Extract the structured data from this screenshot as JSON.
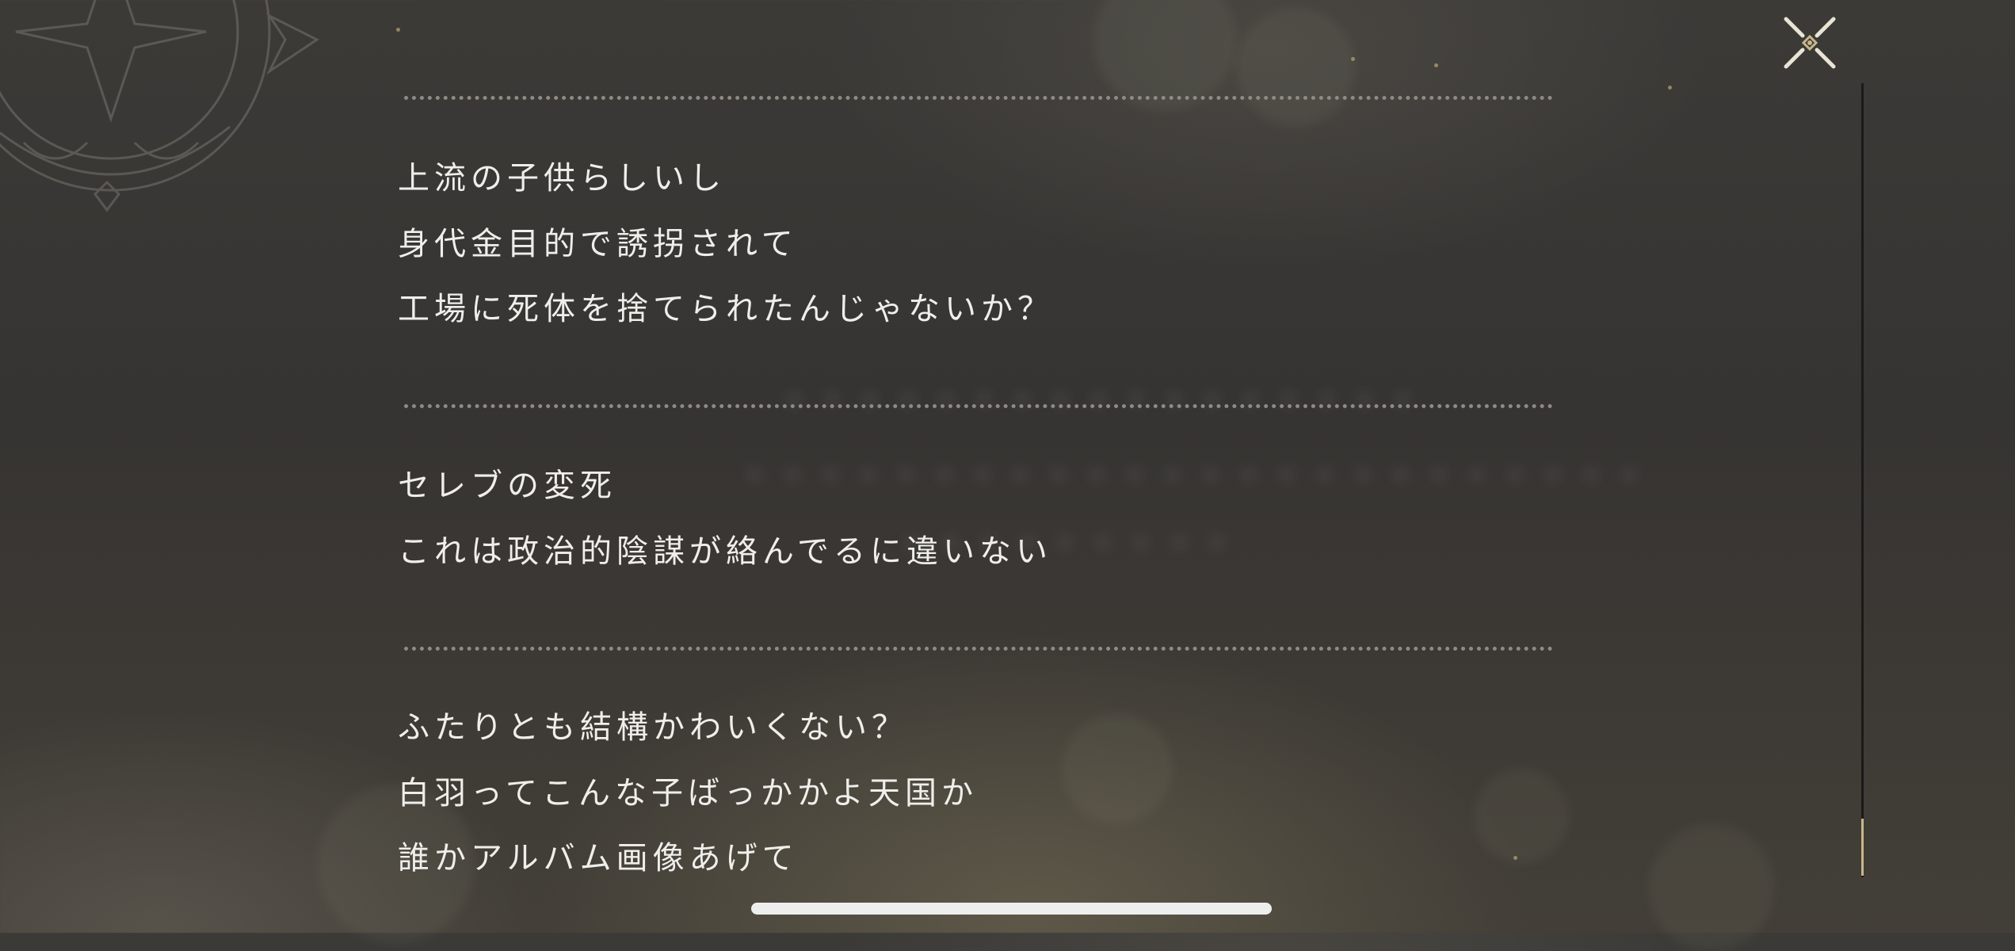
{
  "sections": [
    {
      "lines": [
        "上流の子供らしいし",
        "身代金目的で誘拐されて",
        "工場に死体を捨てられたんじゃないか？"
      ]
    },
    {
      "lines": [
        "セレブの変死",
        "これは政治的陰謀が絡んでるに違いない"
      ]
    },
    {
      "lines": [
        "ふたりとも結構かわいくない？",
        "白羽ってこんな子ばっかかよ天国か",
        "誰かアルバム画像あげて"
      ]
    }
  ],
  "controls": {
    "close_icon": "close-x-icon"
  },
  "colors": {
    "accent": "#c8b68a",
    "text": "#efeeea",
    "divider": "#8e8b84",
    "background": "#383633"
  }
}
